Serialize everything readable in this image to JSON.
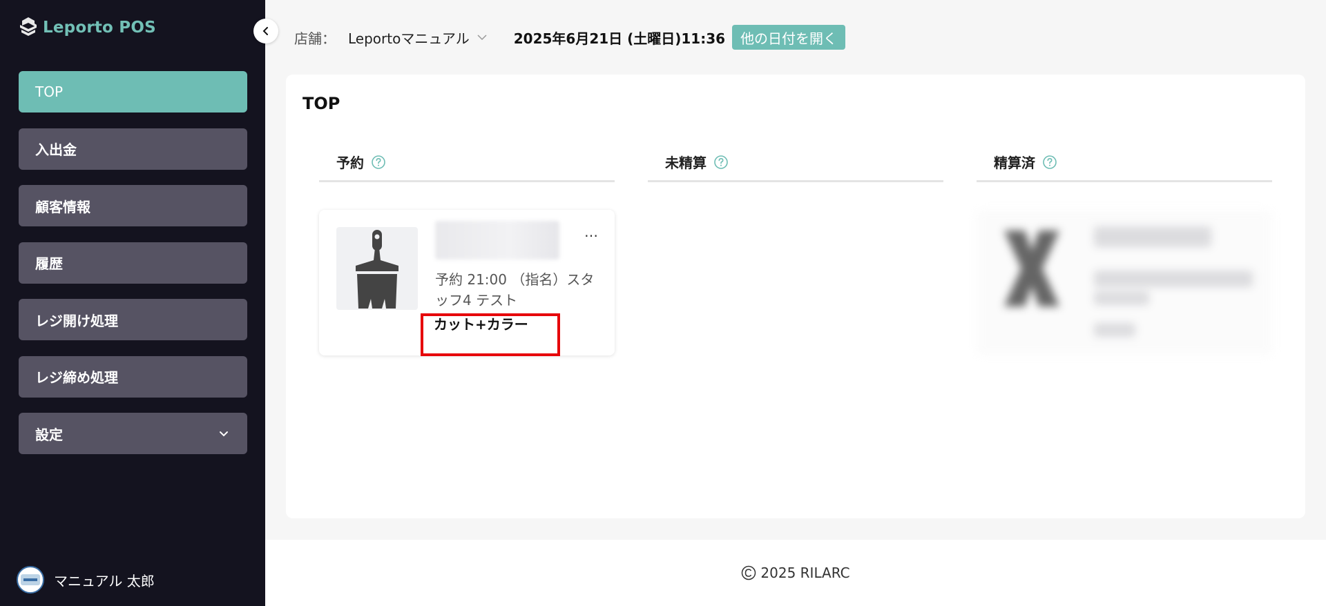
{
  "app": {
    "name": "Leporto POS"
  },
  "sidebar": {
    "items": [
      {
        "label": "TOP"
      },
      {
        "label": "入出金"
      },
      {
        "label": "顧客情報"
      },
      {
        "label": "履歴"
      },
      {
        "label": "レジ開け処理"
      },
      {
        "label": "レジ締め処理"
      },
      {
        "label": "設定"
      }
    ],
    "user_name": "マニュアル 太郎"
  },
  "header": {
    "store_label": "店舗：",
    "store_value": "Leportoマニュアル",
    "datetime": "2025年6月21日 (土曜日)11:36",
    "open_other_date": "他の日付を開く"
  },
  "main": {
    "title": "TOP",
    "columns": [
      {
        "label": "予約"
      },
      {
        "label": "未精算"
      },
      {
        "label": "精算済"
      }
    ],
    "reservation": {
      "more": "…",
      "info": "予約 21:00 （指名）スタッフ4 テスト",
      "menu": "カット+カラー"
    }
  },
  "footer": {
    "copyright": "2025 RILARC"
  },
  "colors": {
    "sidebar_bg": "#14131f",
    "accent": "#6ebdb4",
    "nav_item_bg": "#565363",
    "highlight": "#e6050a"
  },
  "icons": [
    "brush-logo-icon",
    "chevron-left-icon",
    "chevron-down-icon",
    "question-circle-icon",
    "brush-icon",
    "more-horizontal-icon",
    "copyright-icon"
  ]
}
